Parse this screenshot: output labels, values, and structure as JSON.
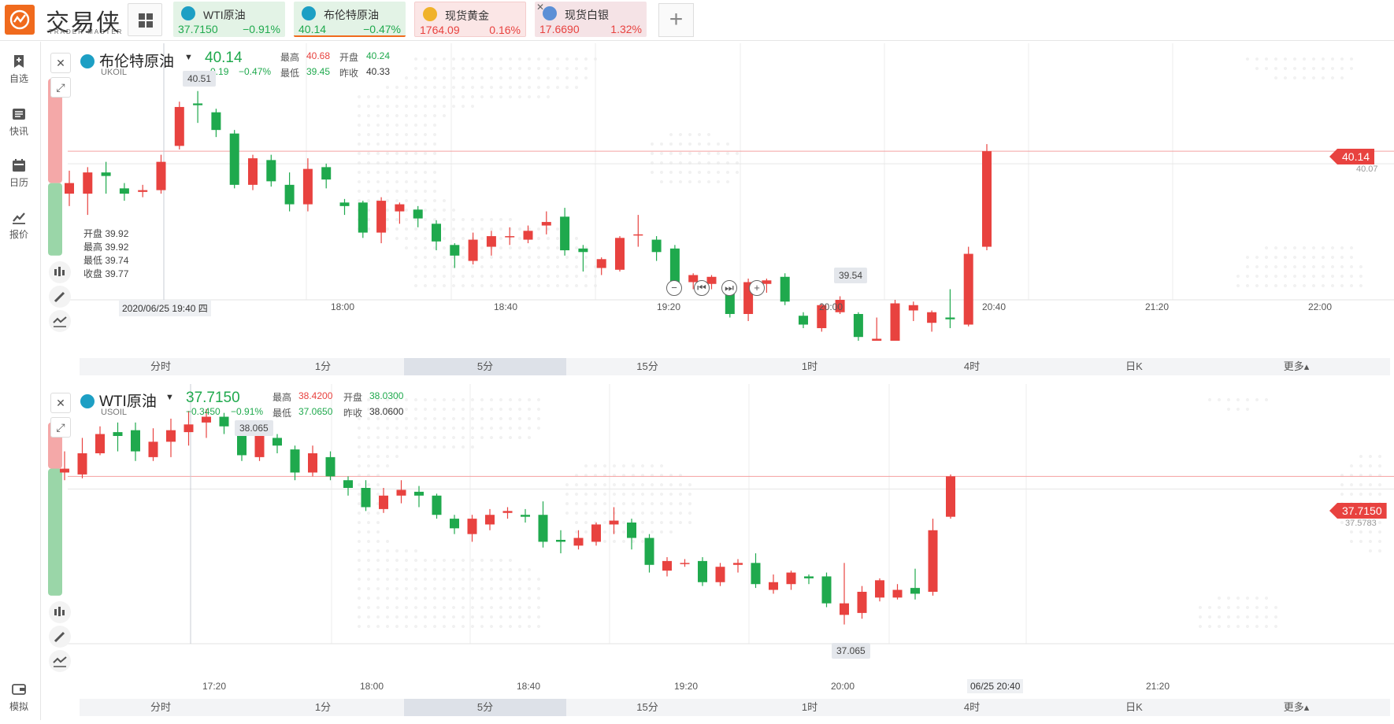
{
  "app": {
    "logo_text": "交易侠",
    "logo_sub": "TRADER MASTER",
    "accent": "#f06a1d"
  },
  "quote_tabs": [
    {
      "name": "WTI原油",
      "price": "37.7150",
      "pct": "−0.91%",
      "trend": "down",
      "icon": "oil-icon"
    },
    {
      "name": "布伦特原油",
      "price": "40.14",
      "pct": "−0.47%",
      "trend": "down",
      "icon": "oil-icon",
      "active": true
    },
    {
      "name": "现货黄金",
      "price": "1764.09",
      "pct": "0.16%",
      "trend": "up",
      "icon": "gold-icon"
    },
    {
      "name": "现货白银",
      "price": "17.6690",
      "pct": "1.32%",
      "trend": "up",
      "icon": "silver-icon"
    }
  ],
  "sidebar": [
    {
      "label": "自选",
      "icon": "bookmark-icon"
    },
    {
      "label": "快讯",
      "icon": "news-icon"
    },
    {
      "label": "日历",
      "icon": "calendar-icon"
    },
    {
      "label": "报价",
      "icon": "chart-line-icon"
    },
    {
      "label": "模拟",
      "icon": "wallet-icon"
    }
  ],
  "timeframes": [
    "分时",
    "1分",
    "5分",
    "15分",
    "1时",
    "4时",
    "日K",
    "更多▴"
  ],
  "active_timeframe": "5分",
  "colors": {
    "up": "#e8423f",
    "down": "#1fa94d"
  },
  "panels": [
    {
      "title": "布伦特原油",
      "code": "UKOIL",
      "price": "40.14",
      "change": "−0.19",
      "change_pct": "−0.47%",
      "labels": {
        "high": "最高",
        "open": "开盘",
        "low": "最低",
        "prev": "昨收"
      },
      "high": "40.68",
      "open": "40.24",
      "low": "39.45",
      "prev_close": "40.33",
      "hover_ohlc": [
        "开盘 39.92",
        "最高 39.92",
        "最低 39.74",
        "收盘 39.77"
      ],
      "crosshair_date": "2020/06/25 19:40 四",
      "x_labels": [
        "18:00",
        "18:40",
        "19:20",
        "20:00",
        "20:40",
        "21:20",
        "22:00"
      ],
      "last_price_tag": "40.14",
      "secondary_price": "40.07",
      "max_tag": "40.51",
      "min_tag": "39.54",
      "chart_data": {
        "type": "candlestick",
        "ylim": [
          39.3,
          40.75
        ],
        "candles": [
          [
            39.9,
            39.96,
            39.83,
            40.03
          ],
          [
            39.9,
            40.02,
            39.78,
            40.05
          ],
          [
            40.02,
            40.0,
            39.9,
            40.08
          ],
          [
            39.93,
            39.9,
            39.86,
            39.96
          ],
          [
            39.91,
            39.92,
            39.88,
            39.95
          ],
          [
            39.92,
            40.08,
            39.9,
            40.12
          ],
          [
            40.17,
            40.39,
            40.15,
            40.42
          ],
          [
            40.41,
            40.4,
            40.3,
            40.48
          ],
          [
            40.36,
            40.26,
            40.22,
            40.38
          ],
          [
            40.24,
            39.95,
            39.93,
            40.26
          ],
          [
            39.95,
            40.1,
            39.92,
            40.12
          ],
          [
            40.09,
            39.97,
            39.94,
            40.12
          ],
          [
            39.95,
            39.84,
            39.8,
            40.02
          ],
          [
            39.84,
            40.04,
            39.8,
            40.1
          ],
          [
            40.05,
            39.98,
            39.93,
            40.07
          ],
          [
            39.85,
            39.83,
            39.78,
            39.87
          ],
          [
            39.85,
            39.68,
            39.65,
            39.86
          ],
          [
            39.68,
            39.86,
            39.62,
            39.88
          ],
          [
            39.8,
            39.84,
            39.73,
            39.85
          ],
          [
            39.81,
            39.76,
            39.71,
            39.83
          ],
          [
            39.73,
            39.63,
            39.58,
            39.75
          ],
          [
            39.61,
            39.55,
            39.48,
            39.62
          ],
          [
            39.52,
            39.64,
            39.5,
            39.68
          ],
          [
            39.6,
            39.66,
            39.55,
            39.69
          ],
          [
            39.66,
            39.66,
            39.61,
            39.71
          ],
          [
            39.64,
            39.69,
            39.62,
            39.72
          ],
          [
            39.72,
            39.74,
            39.67,
            39.8
          ],
          [
            39.77,
            39.58,
            39.55,
            39.82
          ],
          [
            39.59,
            39.57,
            39.46,
            39.61
          ],
          [
            39.48,
            39.53,
            39.44,
            39.54
          ],
          [
            39.47,
            39.65,
            39.46,
            39.66
          ],
          [
            39.67,
            39.67,
            39.6,
            39.78
          ],
          [
            39.64,
            39.57,
            39.52,
            39.66
          ],
          [
            39.59,
            39.38,
            39.35,
            39.61
          ],
          [
            39.4,
            39.44,
            39.36,
            39.45
          ],
          [
            39.39,
            39.43,
            39.36,
            39.44
          ],
          [
            39.37,
            39.22,
            39.2,
            39.38
          ],
          [
            39.22,
            39.4,
            39.18,
            39.42
          ],
          [
            39.39,
            39.41,
            39.34,
            39.42
          ],
          [
            39.43,
            39.29,
            39.27,
            39.45
          ],
          [
            39.21,
            39.16,
            39.14,
            39.23
          ],
          [
            39.14,
            39.27,
            39.12,
            39.28
          ],
          [
            39.23,
            39.3,
            39.22,
            39.32
          ],
          [
            39.22,
            39.09,
            39.05,
            39.23
          ],
          [
            39.02,
            39.08,
            38.82,
            39.2
          ],
          [
            39.02,
            39.28,
            39.0,
            39.3
          ],
          [
            39.24,
            39.27,
            39.18,
            39.29
          ],
          [
            39.17,
            39.23,
            39.12,
            39.24
          ],
          [
            39.2,
            39.19,
            39.14,
            39.36
          ],
          [
            39.16,
            39.56,
            39.15,
            39.6
          ],
          [
            39.6,
            40.14,
            39.58,
            40.18
          ]
        ]
      }
    },
    {
      "title": "WTI原油",
      "code": "USOIL",
      "price": "37.7150",
      "change": "−0.3450",
      "change_pct": "−0.91%",
      "labels": {
        "high": "最高",
        "open": "开盘",
        "low": "最低",
        "prev": "昨收"
      },
      "high": "38.4200",
      "open": "38.0300",
      "low": "37.0650",
      "prev_close": "38.0600",
      "hover_ohlc": [],
      "crosshair_date": "06/25 20:40",
      "x_labels": [
        "17:20",
        "18:00",
        "18:40",
        "19:20",
        "20:00",
        "20:40",
        "21:20"
      ],
      "last_price_tag": "37.7150",
      "secondary_price": "37.5783",
      "max_tag": "38.065",
      "min_tag": "37.065",
      "chart_data": {
        "type": "candlestick",
        "ylim": [
          36.85,
          38.2
        ],
        "candles": [
          [
            37.74,
            37.76,
            37.7,
            37.85
          ],
          [
            37.73,
            37.84,
            37.71,
            37.92
          ],
          [
            37.84,
            37.94,
            37.83,
            37.98
          ],
          [
            37.95,
            37.93,
            37.85,
            38.0
          ],
          [
            37.96,
            37.85,
            37.8,
            38.0
          ],
          [
            37.82,
            37.9,
            37.8,
            37.97
          ],
          [
            37.9,
            37.96,
            37.82,
            38.02
          ],
          [
            37.95,
            37.99,
            37.88,
            38.06
          ],
          [
            38.0,
            38.03,
            37.92,
            38.07
          ],
          [
            38.03,
            37.98,
            37.94,
            38.05
          ],
          [
            37.95,
            37.83,
            37.8,
            38.0
          ],
          [
            37.82,
            37.95,
            37.8,
            37.96
          ],
          [
            37.92,
            37.88,
            37.84,
            37.94
          ],
          [
            37.86,
            37.74,
            37.7,
            37.88
          ],
          [
            37.74,
            37.84,
            37.72,
            37.88
          ],
          [
            37.82,
            37.72,
            37.7,
            37.85
          ],
          [
            37.7,
            37.66,
            37.62,
            37.72
          ],
          [
            37.66,
            37.56,
            37.54,
            37.7
          ],
          [
            37.55,
            37.62,
            37.53,
            37.66
          ],
          [
            37.62,
            37.65,
            37.58,
            37.7
          ],
          [
            37.64,
            37.62,
            37.56,
            37.67
          ],
          [
            37.62,
            37.52,
            37.5,
            37.63
          ],
          [
            37.5,
            37.45,
            37.42,
            37.52
          ],
          [
            37.42,
            37.5,
            37.38,
            37.52
          ],
          [
            37.47,
            37.52,
            37.44,
            37.55
          ],
          [
            37.53,
            37.54,
            37.5,
            37.56
          ],
          [
            37.52,
            37.51,
            37.48,
            37.55
          ],
          [
            37.52,
            37.38,
            37.35,
            37.59
          ],
          [
            37.39,
            37.38,
            37.32,
            37.44
          ],
          [
            37.36,
            37.4,
            37.34,
            37.44
          ],
          [
            37.38,
            37.47,
            37.36,
            37.48
          ],
          [
            37.47,
            37.49,
            37.42,
            37.56
          ],
          [
            37.48,
            37.4,
            37.34,
            37.5
          ],
          [
            37.4,
            37.26,
            37.22,
            37.42
          ],
          [
            37.23,
            37.28,
            37.2,
            37.3
          ],
          [
            37.27,
            37.27,
            37.25,
            37.29
          ],
          [
            37.28,
            37.17,
            37.15,
            37.3
          ],
          [
            37.17,
            37.25,
            37.15,
            37.27
          ],
          [
            37.26,
            37.27,
            37.22,
            37.29
          ],
          [
            37.27,
            37.16,
            37.14,
            37.32
          ],
          [
            37.13,
            37.17,
            37.11,
            37.21
          ],
          [
            37.16,
            37.22,
            37.13,
            37.23
          ],
          [
            37.2,
            37.19,
            37.16,
            37.21
          ],
          [
            37.2,
            37.06,
            37.04,
            37.22
          ],
          [
            37.0,
            37.06,
            36.95,
            37.27
          ],
          [
            37.01,
            37.12,
            36.98,
            37.15
          ],
          [
            37.09,
            37.18,
            37.07,
            37.19
          ],
          [
            37.09,
            37.13,
            37.08,
            37.16
          ],
          [
            37.14,
            37.11,
            37.08,
            37.24
          ],
          [
            37.12,
            37.44,
            37.1,
            37.5
          ],
          [
            37.51,
            37.72,
            37.5,
            37.73
          ]
        ]
      }
    }
  ]
}
